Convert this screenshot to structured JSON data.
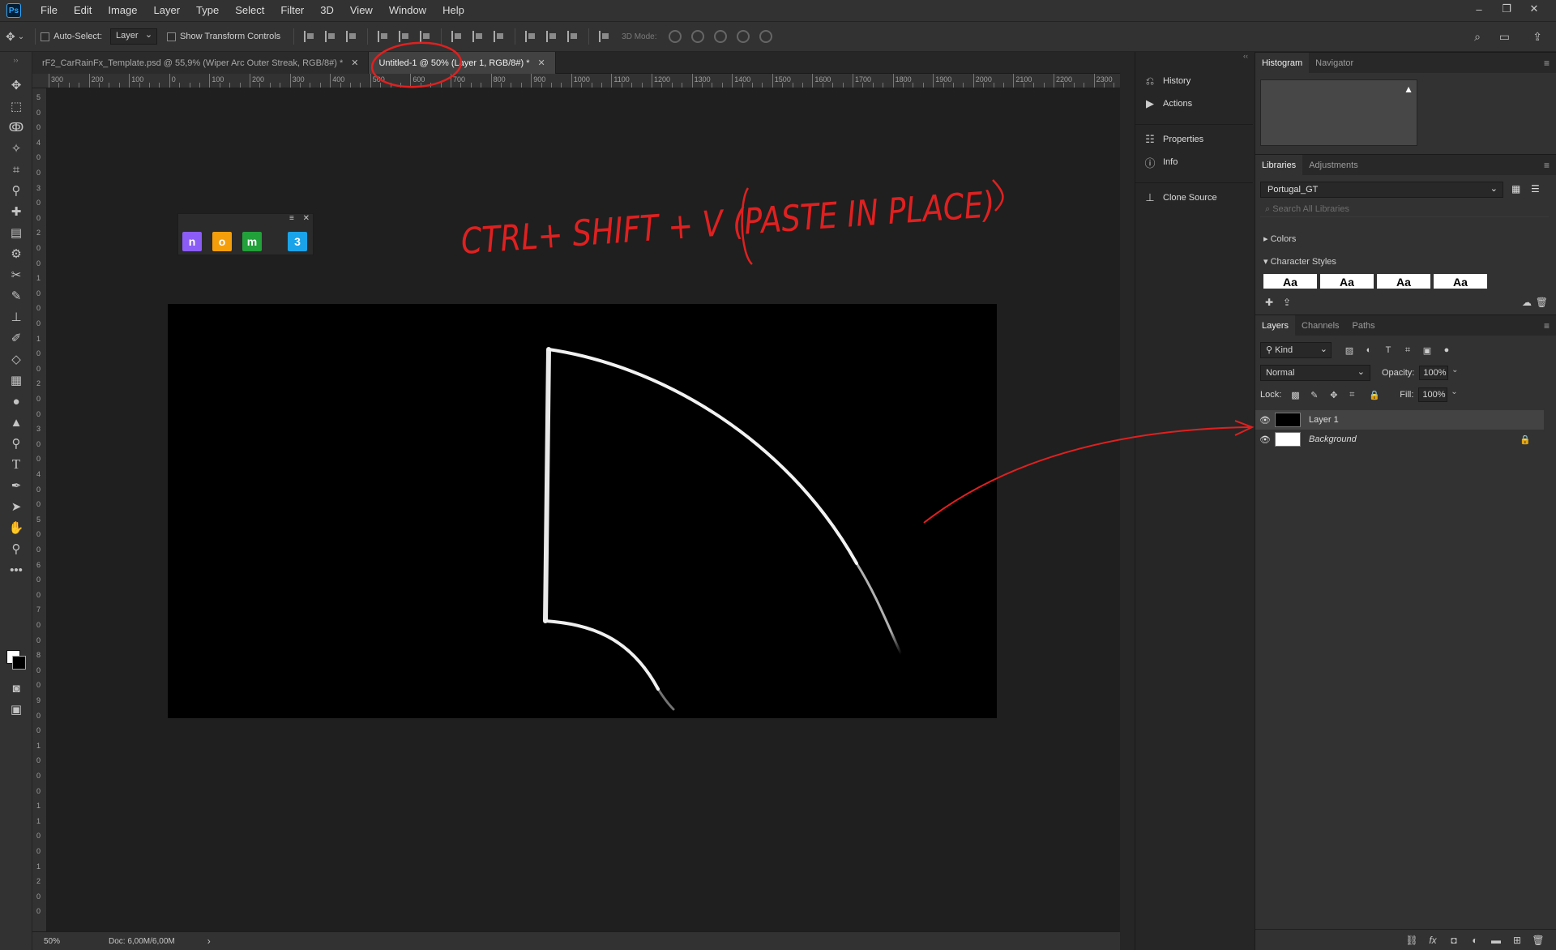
{
  "app": {
    "logo": "Ps",
    "accent": "#31a8ff"
  },
  "menu": [
    "File",
    "Edit",
    "Image",
    "Layer",
    "Type",
    "Select",
    "Filter",
    "3D",
    "View",
    "Window",
    "Help"
  ],
  "window_controls": {
    "minimize": "–",
    "restore": "❐",
    "close": "✕"
  },
  "options_bar": {
    "auto_select_label": "Auto-Select:",
    "auto_select_target": "Layer",
    "show_transform_label": "Show Transform Controls",
    "mode_3d_label": "3D Mode:"
  },
  "tabs": [
    {
      "label": "rF2_CarRainFx_Template.psd @ 55,9% (Wiper Arc Outer Streak, RGB/8#) *",
      "active": false
    },
    {
      "label": "Untitled-1 @ 50% (Layer 1, RGB/8#) *",
      "active": true
    }
  ],
  "ruler_top_labels": [
    "300",
    "200",
    "100",
    "0",
    "100",
    "200",
    "300",
    "400",
    "500",
    "600",
    "700",
    "800",
    "900",
    "1000",
    "1100",
    "1200",
    "1300",
    "1400",
    "1500",
    "1600",
    "1700",
    "1800",
    "1900",
    "2000",
    "2100",
    "2200",
    "2300"
  ],
  "ruler_left_labels": [
    "5",
    "0",
    "0",
    "4",
    "0",
    "0",
    "3",
    "0",
    "0",
    "2",
    "0",
    "0",
    "1",
    "0",
    "0",
    "0",
    "1",
    "0",
    "0",
    "2",
    "0",
    "0",
    "3",
    "0",
    "0",
    "4",
    "0",
    "0",
    "5",
    "0",
    "0",
    "6",
    "0",
    "0",
    "7",
    "0",
    "0",
    "8",
    "0",
    "0",
    "9",
    "0",
    "0",
    "1",
    "0",
    "0",
    "0",
    "1",
    "1",
    "0",
    "0",
    "1",
    "2",
    "0",
    "0"
  ],
  "status": {
    "zoom": "50%",
    "doc": "Doc: 6,00M/6,00M",
    "arrow": "›"
  },
  "annotation": {
    "text": "CTRL+ SHIFT + V  (PASTE IN PLACE)",
    "color": "#e02020"
  },
  "mini_panel": {
    "icons": [
      {
        "glyph": "n",
        "color": "#8b5cf6"
      },
      {
        "glyph": "o",
        "color": "#f59e0b"
      },
      {
        "glyph": "m",
        "color": "#22a03a"
      },
      {
        "glyph": "3",
        "color": "#1aa3e8"
      }
    ]
  },
  "dock": [
    {
      "icon": "history-icon",
      "label": "History"
    },
    {
      "icon": "actions-icon",
      "label": "Actions"
    },
    {
      "icon": "properties-icon",
      "label": "Properties"
    },
    {
      "icon": "info-icon",
      "label": "Info"
    },
    {
      "icon": "clone-source-icon",
      "label": "Clone Source"
    }
  ],
  "panels": {
    "histogram_tabs": [
      "Histogram",
      "Navigator"
    ],
    "libraries_tabs": [
      "Libraries",
      "Adjustments"
    ],
    "library_name": "Portugal_GT",
    "library_search_placeholder": "Search All Libraries",
    "library_sections": [
      "Colors",
      "Character Styles"
    ],
    "character_style_sample": "Aa",
    "layers_tabs": [
      "Layers",
      "Channels",
      "Paths"
    ],
    "kind_label": "Kind",
    "blend_mode": "Normal",
    "opacity_label": "Opacity:",
    "opacity_value": "100%",
    "lock_label": "Lock:",
    "fill_label": "Fill:",
    "fill_value": "100%",
    "layers": [
      {
        "name": "Layer 1",
        "selected": true,
        "thumb": "#000000"
      },
      {
        "name": "Background",
        "selected": false,
        "thumb": "#ffffff",
        "locked": true
      }
    ]
  }
}
